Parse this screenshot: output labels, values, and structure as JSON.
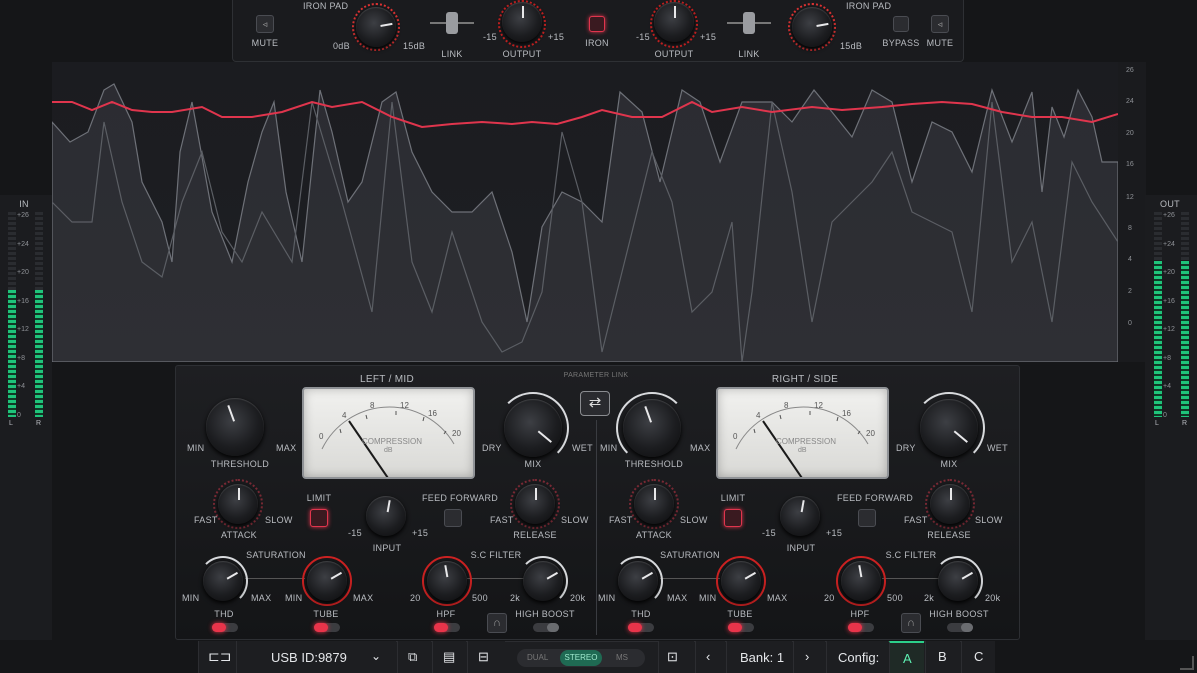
{
  "top": {
    "mute_left": "MUTE",
    "iron_pad_left": "IRON PAD",
    "pad_min_left": "0dB",
    "pad_max_left": "15dB",
    "link_left": "LINK",
    "output_left": "OUTPUT",
    "out_min_left": "-15",
    "out_max_left": "+15",
    "iron": "IRON",
    "output_right": "OUTPUT",
    "out_min_right": "-15",
    "out_max_right": "+15",
    "link_right": "LINK",
    "iron_pad_right": "IRON PAD",
    "pad_max_right": "15dB",
    "bypass": "BYPASS",
    "mute_right": "MUTE"
  },
  "graph": {
    "scale": [
      "26",
      "24",
      "20",
      "16",
      "12",
      "8",
      "4",
      "2",
      "0"
    ]
  },
  "meters": {
    "in_label": "IN",
    "out_label": "OUT",
    "in_l": "L",
    "in_r": "R",
    "out_l": "L",
    "out_r": "R",
    "scale": [
      "+26",
      "+24",
      "+20",
      "+16",
      "+12",
      "+8",
      "+4",
      "0"
    ],
    "in_level": 0.62,
    "out_level": 0.76
  },
  "panel": {
    "parameter_link": "PARAMETER LINK",
    "left": {
      "title": "LEFT / MID",
      "threshold": "THRESHOLD",
      "min": "MIN",
      "max": "MAX",
      "mix": "MIX",
      "dry": "DRY",
      "wet": "WET",
      "meter_caption": "COMPRESSION",
      "meter_unit": "dB",
      "attack": "ATTACK",
      "fast": "FAST",
      "slow": "SLOW",
      "limit": "LIMIT",
      "input": "INPUT",
      "in_min": "-15",
      "in_max": "+15",
      "feed_forward": "FEED FORWARD",
      "release": "RELEASE",
      "rel_fast": "FAST",
      "rel_slow": "SLOW",
      "saturation": "SATURATION",
      "thd": "THD",
      "thd_min": "MIN",
      "thd_max": "MAX",
      "tube": "TUBE",
      "tube_min": "MIN",
      "tube_max": "MAX",
      "sc_filter": "S.C FILTER",
      "hpf": "HPF",
      "hpf_min": "20",
      "hpf_max": "500",
      "high_boost": "HIGH BOOST",
      "hb_min": "2k",
      "hb_max": "20k"
    },
    "right": {
      "title": "RIGHT / SIDE",
      "threshold": "THRESHOLD",
      "min": "MIN",
      "max": "MAX",
      "mix": "MIX",
      "dry": "DRY",
      "wet": "WET",
      "meter_caption": "COMPRESSION",
      "meter_unit": "dB",
      "attack": "ATTACK",
      "fast": "FAST",
      "slow": "SLOW",
      "limit": "LIMIT",
      "input": "INPUT",
      "in_min": "-15",
      "in_max": "+15",
      "feed_forward": "FEED FORWARD",
      "release": "RELEASE",
      "rel_fast": "FAST",
      "rel_slow": "SLOW",
      "saturation": "SATURATION",
      "thd": "THD",
      "thd_min": "MIN",
      "thd_max": "MAX",
      "tube": "TUBE",
      "tube_min": "MIN",
      "tube_max": "MAX",
      "sc_filter": "S.C FILTER",
      "hpf": "HPF",
      "hpf_min": "20",
      "hpf_max": "500",
      "high_boost": "HIGH BOOST",
      "hb_min": "2k",
      "hb_max": "20k"
    },
    "vu_ticks": [
      "0",
      "4",
      "8",
      "12",
      "16",
      "20"
    ]
  },
  "bottom": {
    "usb_id": "USB ID:9879",
    "mode_dual": "DUAL",
    "mode_stereo": "STEREO",
    "mode_ms": "MS",
    "bank": "Bank: 1",
    "config": "Config:",
    "config_a": "A",
    "config_b": "B",
    "config_c": "C"
  },
  "colors": {
    "accent_red": "#e8344a",
    "meter_green": "#1fc47a",
    "config_green": "#2ccf8a"
  }
}
